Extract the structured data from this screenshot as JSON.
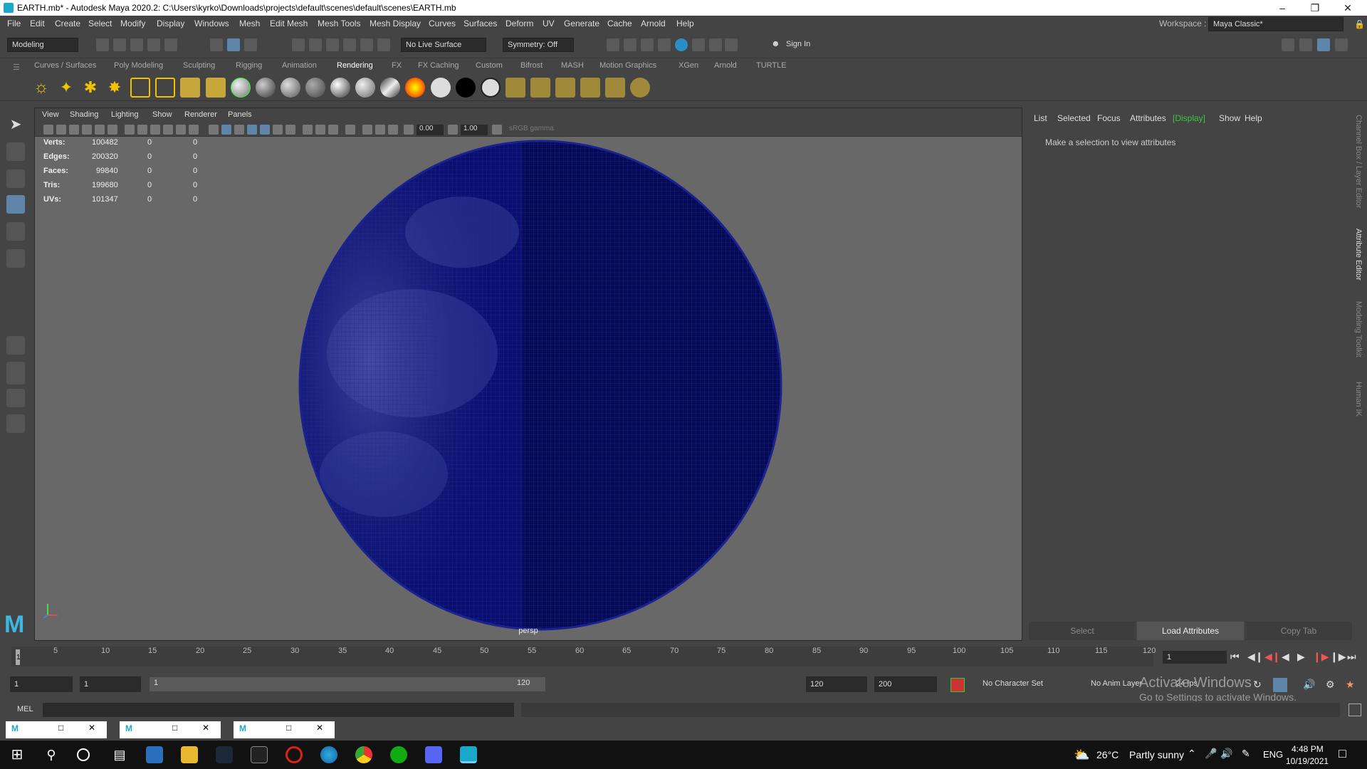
{
  "window": {
    "title": "EARTH.mb* - Autodesk Maya 2020.2: C:\\Users\\kyrko\\Downloads\\projects\\default\\scenes\\default\\scenes\\EARTH.mb",
    "minimize": "–",
    "maximize": "❐",
    "close": "✕"
  },
  "menus": [
    "File",
    "Edit",
    "Create",
    "Select",
    "Modify",
    "Display",
    "Windows",
    "Mesh",
    "Edit Mesh",
    "Mesh Tools",
    "Mesh Display",
    "Curves",
    "Surfaces",
    "Deform",
    "UV",
    "Generate",
    "Cache",
    "Arnold",
    "Help"
  ],
  "workspace": {
    "label": "Workspace :",
    "value": "Maya Classic*"
  },
  "statusline": {
    "mode": "Modeling",
    "live_surface": "No Live Surface",
    "symmetry": "Symmetry: Off",
    "sign_in": "Sign In"
  },
  "shelf_tabs": [
    "Curves / Surfaces",
    "Poly Modeling",
    "Sculpting",
    "Rigging",
    "Animation",
    "Rendering",
    "FX",
    "FX Caching",
    "Custom",
    "Bifrost",
    "MASH",
    "Motion Graphics",
    "XGen",
    "Arnold",
    "TURTLE"
  ],
  "active_shelf_tab": "Rendering",
  "viewport": {
    "menus": [
      "View",
      "Shading",
      "Lighting",
      "Show",
      "Renderer",
      "Panels"
    ],
    "exposure": "0.00",
    "gamma": "1.00",
    "color_space": "sRGB gamma",
    "camera": "persp",
    "hud": [
      {
        "label": "Verts:",
        "v1": "100482",
        "v2": "0",
        "v3": "0"
      },
      {
        "label": "Edges:",
        "v1": "200320",
        "v2": "0",
        "v3": "0"
      },
      {
        "label": "Faces:",
        "v1": "99840",
        "v2": "0",
        "v3": "0"
      },
      {
        "label": "Tris:",
        "v1": "199680",
        "v2": "0",
        "v3": "0"
      },
      {
        "label": "UVs:",
        "v1": "101347",
        "v2": "0",
        "v3": "0"
      }
    ],
    "globe_color": "#0a0f6e"
  },
  "attribute_editor": {
    "menus": [
      "List",
      "Selected",
      "Focus",
      "Attributes",
      "[Display]",
      "Show",
      "Help"
    ],
    "message": "Make a selection to view attributes",
    "buttons": {
      "select": "Select",
      "load": "Load Attributes",
      "copy": "Copy Tab"
    }
  },
  "side_tabs": [
    "Channel Box / Layer Editor",
    "Attribute Editor",
    "Modeling Toolkit",
    "Human IK"
  ],
  "timeline": {
    "ticks": [
      "1",
      "5",
      "10",
      "15",
      "20",
      "25",
      "30",
      "35",
      "40",
      "45",
      "50",
      "55",
      "60",
      "65",
      "70",
      "75",
      "80",
      "85",
      "90",
      "95",
      "100",
      "105",
      "110",
      "115",
      "120"
    ],
    "current_frame": "1"
  },
  "range": {
    "start": "1",
    "playback_start": "1",
    "slider_start": "1",
    "slider_end": "120",
    "playback_end": "120",
    "end": "200",
    "character_set": "No Character Set",
    "anim_layer": "No Anim Layer",
    "fps": "24 fps"
  },
  "mel": {
    "label": "MEL"
  },
  "activation": {
    "line1": "Activate Windows",
    "line2": "Go to Settings to activate Windows."
  },
  "taskbar": {
    "temperature": "26°C",
    "weather": "Partly sunny",
    "language": "ENG",
    "time": "4:48 PM",
    "date": "10/19/2021"
  }
}
